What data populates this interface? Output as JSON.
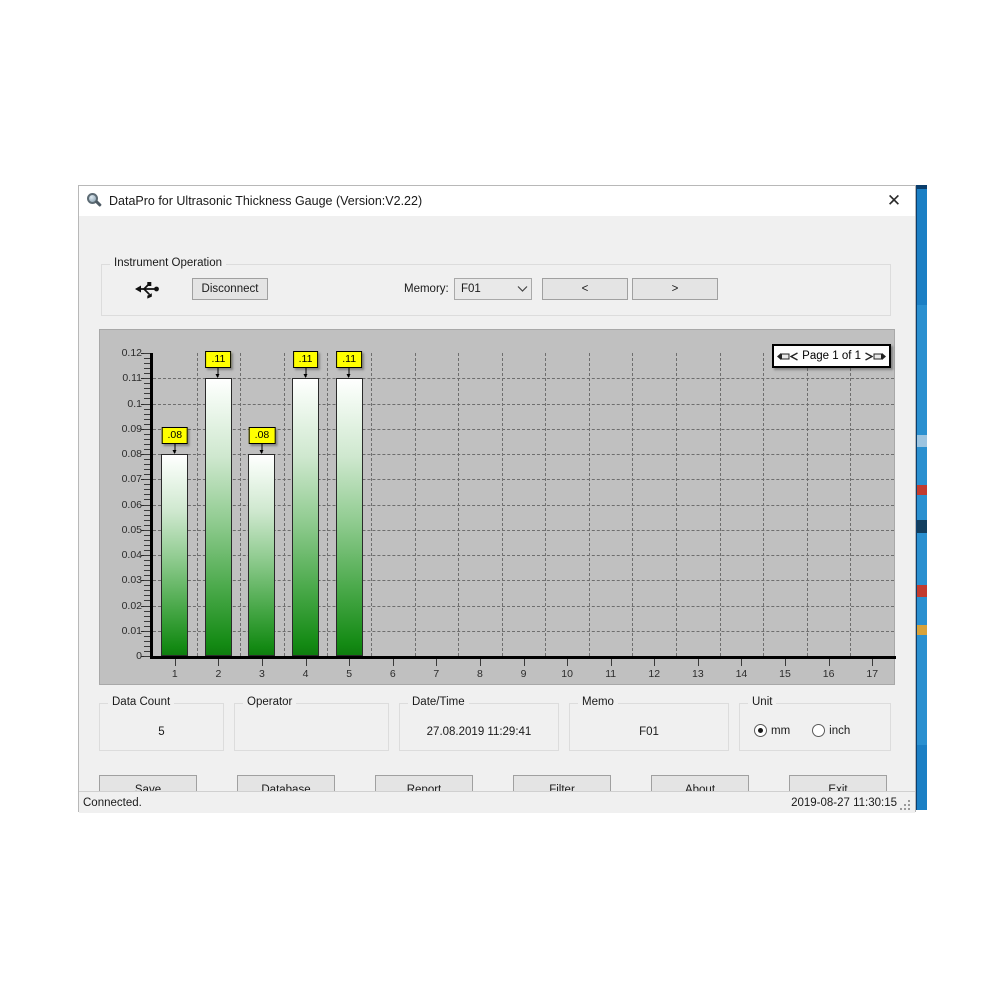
{
  "window": {
    "title": "DataPro for Ultrasonic Thickness Gauge (Version:V2.22)",
    "app_icon": "magnifier-icon",
    "close_label": "✕"
  },
  "instrument_operation": {
    "legend": "Instrument Operation",
    "usb_icon": "usb-icon",
    "disconnect_label": "Disconnect",
    "memory_label": "Memory:",
    "memory_value": "F01",
    "memory_options": [
      "F01"
    ],
    "prev_label": "<",
    "next_label": ">"
  },
  "chart_nav": {
    "page_text": "Page 1 of 1",
    "prev_icon": "arrow-left-icon",
    "next_icon": "arrow-right-icon"
  },
  "chart_data": {
    "type": "bar",
    "title": "",
    "xlabel": "",
    "ylabel": "",
    "categories": [
      "1",
      "2",
      "3",
      "4",
      "5",
      "6",
      "7",
      "8",
      "9",
      "10",
      "11",
      "12",
      "13",
      "14",
      "15",
      "16",
      "17"
    ],
    "values": [
      0.08,
      0.11,
      0.08,
      0.11,
      0.11,
      null,
      null,
      null,
      null,
      null,
      null,
      null,
      null,
      null,
      null,
      null,
      null
    ],
    "data_labels": [
      ".08",
      ".11",
      ".08",
      ".11",
      ".11"
    ],
    "ylim": [
      0,
      0.12
    ],
    "ytick_labels": [
      "0.12",
      "0.11",
      "0.1",
      "0.09",
      "0.08",
      "0.07",
      "0.06",
      "0.05",
      "0.04",
      "0.03",
      "0.02",
      "0.01",
      "0"
    ],
    "ytick_values": [
      0.12,
      0.11,
      0.1,
      0.09,
      0.08,
      0.07,
      0.06,
      0.05,
      0.04,
      0.03,
      0.02,
      0.01,
      0
    ],
    "grid": true,
    "legend": "none",
    "plot_bg": "#c0c0c0",
    "bar_color_top": "#ffffff",
    "bar_color_bottom": "#0e7d0e",
    "label_bg": "#ffff00"
  },
  "info": {
    "data_count": {
      "legend": "Data Count",
      "value": "5"
    },
    "operator": {
      "legend": "Operator",
      "value": ""
    },
    "datetime": {
      "legend": "Date/Time",
      "value": "27.08.2019 11:29:41"
    },
    "memo": {
      "legend": "Memo",
      "value": "F01"
    },
    "unit": {
      "legend": "Unit",
      "mm_label": "mm",
      "inch_label": "inch",
      "selected": "mm"
    }
  },
  "actions": {
    "save": "Save",
    "database": "Database",
    "report": "Report",
    "filter": "Filter",
    "about": "About",
    "exit": "Exit"
  },
  "status": {
    "message": "Connected.",
    "timestamp": "2019-08-27 11:30:15"
  }
}
